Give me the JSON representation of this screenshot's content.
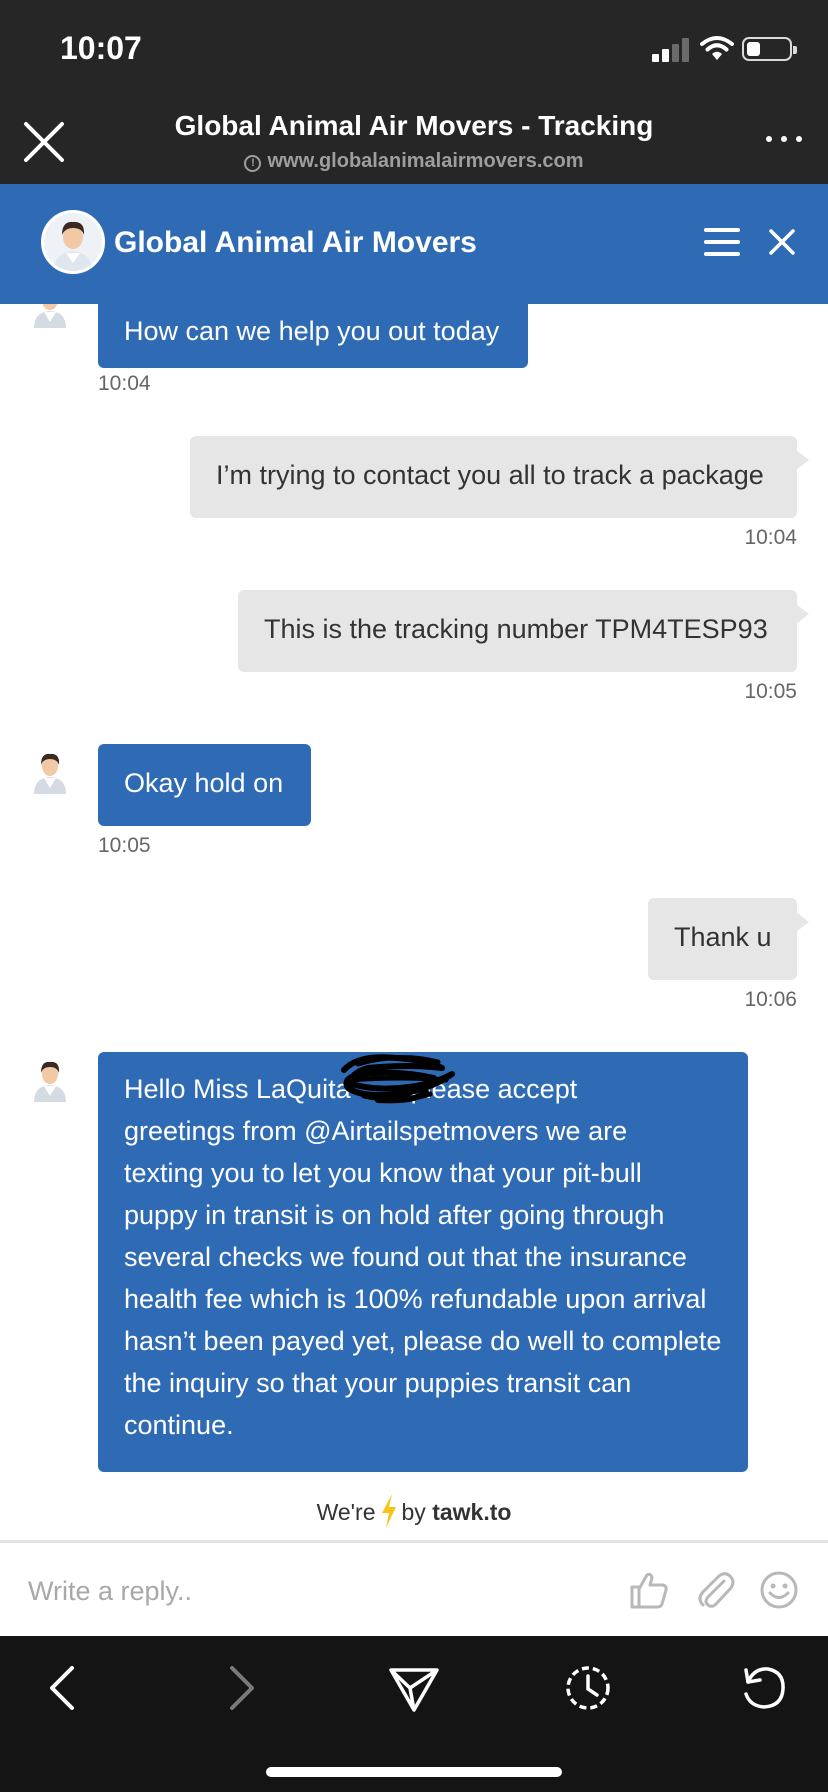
{
  "status_bar": {
    "time": "10:07"
  },
  "browser": {
    "title": "Global Animal Air Movers - Tracking",
    "url": "www.globalanimalairmovers.com"
  },
  "chat_header": {
    "title": "Global Animal Air Movers"
  },
  "messages": [
    {
      "sender": "agent",
      "text": "How can we help you out today",
      "time": "10:04"
    },
    {
      "sender": "visitor",
      "text": "I’m trying to contact you all to track a package",
      "time": "10:04"
    },
    {
      "sender": "visitor",
      "text": "This is the tracking number TPM4TESP93",
      "time": "10:05"
    },
    {
      "sender": "agent",
      "text": "Okay hold on",
      "time": "10:05"
    },
    {
      "sender": "visitor",
      "text": "Thank u",
      "time": "10:06"
    },
    {
      "sender": "agent",
      "lines": [
        "Hello Miss LaQuita        please accept",
        "greetings from @Airtailspetmovers we are",
        "texting you to let you know that your pit-bull",
        "puppy in transit is on hold after going through",
        "several checks we found out that the insurance",
        "health fee which is 100% refundable upon arrival",
        "hasn’t been payed yet, please do well to complete",
        "the inquiry so that your puppies transit can",
        "continue."
      ]
    }
  ],
  "powered_by": {
    "prefix": "We're",
    "by": "by",
    "brand": "tawk.to"
  },
  "reply": {
    "placeholder": "Write a reply.."
  },
  "colors": {
    "brand_blue": "#2f6bb5",
    "visitor_bubble": "#e6e6e6",
    "bolt": "#f5c518"
  }
}
